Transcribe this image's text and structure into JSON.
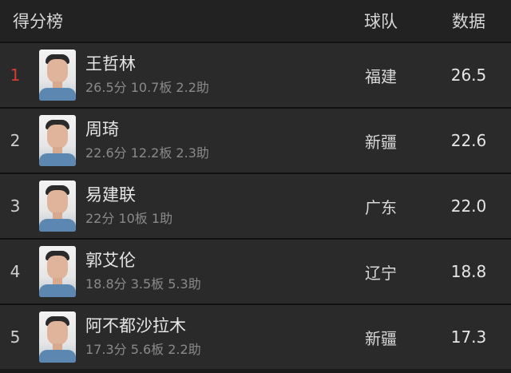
{
  "header": {
    "title": "得分榜",
    "team_col": "球队",
    "data_col": "数据"
  },
  "colors": {
    "rank_highlight": "#d83a34"
  },
  "players": [
    {
      "rank": "1",
      "name": "王哲林",
      "stats": "26.5分 10.7板 2.2助",
      "team": "福建",
      "value": "26.5"
    },
    {
      "rank": "2",
      "name": "周琦",
      "stats": "22.6分 12.2板 2.3助",
      "team": "新疆",
      "value": "22.6"
    },
    {
      "rank": "3",
      "name": "易建联",
      "stats": "22分 10板 1助",
      "team": "广东",
      "value": "22.0"
    },
    {
      "rank": "4",
      "name": "郭艾伦",
      "stats": "18.8分 3.5板 5.3助",
      "team": "辽宁",
      "value": "18.8"
    },
    {
      "rank": "5",
      "name": "阿不都沙拉木",
      "stats": "17.3分 5.6板 2.2助",
      "team": "新疆",
      "value": "17.3"
    }
  ]
}
